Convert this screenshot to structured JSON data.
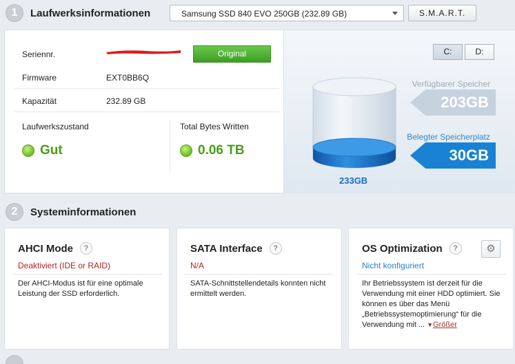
{
  "section1": {
    "number": "1",
    "title": "Laufwerksinformationen"
  },
  "drive_select": {
    "value": "Samsung SSD 840 EVO 250GB (232.89 GB)"
  },
  "smart_button": "S.M.A.R.T.",
  "info": {
    "serial_label": "Seriennr.",
    "original_button": "Original",
    "firmware_label": "Firmware",
    "firmware_value": "EXT0BB6Q",
    "capacity_label": "Kapazität",
    "capacity_value": "232.89 GB",
    "status_label": "Laufwerkszustand",
    "status_value": "Gut",
    "tbw_label": "Total Bytes Written",
    "tbw_value": "0.06 TB"
  },
  "drive_panel": {
    "drive_c": "C:",
    "drive_d": "D:",
    "free_label": "Verfügbarer Speicher",
    "free_value": "203GB",
    "used_label": "Belegter Speicherplatz",
    "used_value": "30GB",
    "total_value": "233GB"
  },
  "section2": {
    "number": "2",
    "title": "Systeminformationen"
  },
  "cards": [
    {
      "title": "AHCI Mode",
      "status": "Deaktiviert (IDE or RAID)",
      "status_color": "#b22222",
      "desc": "Der AHCI-Modus ist für eine optimale Leistung der SSD erforderlich."
    },
    {
      "title": "SATA Interface",
      "status": "N/A",
      "status_color": "#b22222",
      "desc": "SATA-Schnittstellendetails konnten nicht ermittelt werden."
    },
    {
      "title": "OS Optimization",
      "status": "Nicht konfiguriert",
      "status_color": "#2a7fc8",
      "desc": "Ihr Betriebssystem ist derzeit für die Verwendung mit einer HDD optimiert. Sie können es über das Menü „Betriebssystemoptimierung“ für die Verwendung mit ...",
      "more": "Größer"
    }
  ],
  "icons": {
    "help": "question-icon",
    "settings": "gear-icon",
    "expand": "triangle-down-icon"
  },
  "colors": {
    "good": "#4a9e17",
    "accent": "#1a82d4",
    "warning": "#b22222"
  }
}
